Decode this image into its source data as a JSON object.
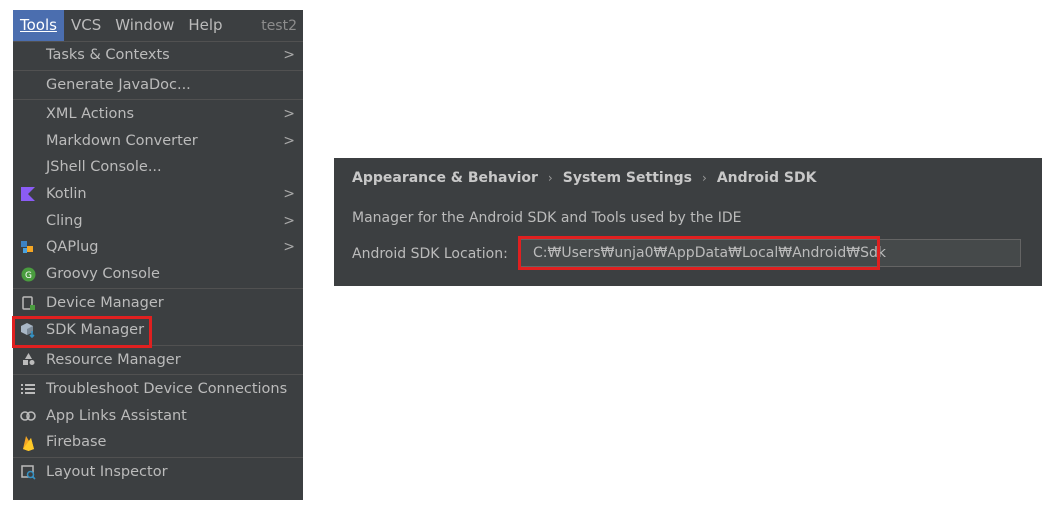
{
  "menubar": {
    "items": [
      {
        "label": "Tools"
      },
      {
        "label": "VCS"
      },
      {
        "label": "Window"
      },
      {
        "label": "Help"
      }
    ],
    "project_title": "test2"
  },
  "tools_menu": {
    "items": [
      {
        "label": "Tasks & Contexts",
        "submenu": true
      },
      {
        "label": "Generate JavaDoc..."
      },
      {
        "label": "XML Actions",
        "submenu": true
      },
      {
        "label": "Markdown Converter",
        "submenu": true
      },
      {
        "label": "JShell Console..."
      },
      {
        "label": "Kotlin",
        "submenu": true,
        "icon": "kotlin-icon"
      },
      {
        "label": "Cling",
        "submenu": true
      },
      {
        "label": "QAPlug",
        "submenu": true,
        "icon": "qaplug-icon"
      },
      {
        "label": "Groovy Console",
        "icon": "groovy-icon"
      },
      {
        "label": "Device Manager",
        "icon": "device-manager-icon"
      },
      {
        "label": "SDK Manager",
        "icon": "sdk-manager-icon"
      },
      {
        "label": "Resource Manager",
        "icon": "resource-manager-icon"
      },
      {
        "label": "Troubleshoot Device Connections",
        "icon": "troubleshoot-icon"
      },
      {
        "label": "App Links Assistant",
        "icon": "link-icon"
      },
      {
        "label": "Firebase",
        "icon": "firebase-icon"
      },
      {
        "label": "Layout Inspector",
        "icon": "layout-inspector-icon"
      }
    ],
    "arrow_glyph": ">"
  },
  "sdk_settings": {
    "breadcrumb": [
      "Appearance & Behavior",
      "System Settings",
      "Android SDK"
    ],
    "breadcrumb_sep": "›",
    "description": "Manager for the Android SDK and Tools used by the IDE",
    "location_label": "Android SDK Location:",
    "location_value": "C:₩Users₩unja0₩AppData₩Local₩Android₩Sdk"
  },
  "colors": {
    "panel_bg": "#3c3f41",
    "menu_active": "#4b6eaf",
    "highlight_red": "#e02020",
    "kotlin": "#8b5cf6",
    "groovy": "#4a9c3f",
    "firebase": "#f5a623"
  }
}
